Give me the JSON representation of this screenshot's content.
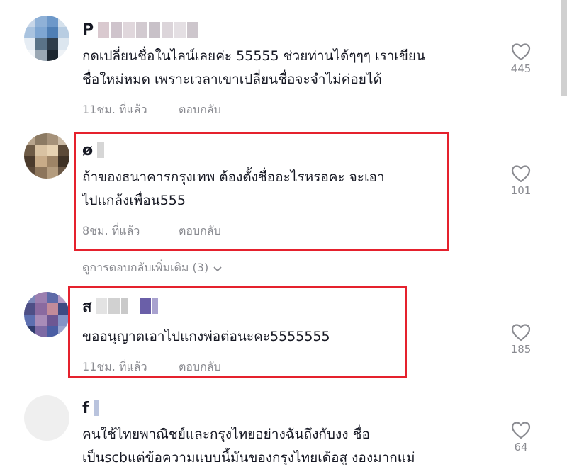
{
  "comments": [
    {
      "name_initial": "P",
      "text_line1": "กดเปลี่ยนชื่อในไลน์เลยค่ะ 55555 ช่วยท่านได้ๆๆๆ เราเขียน",
      "text_line2": "ชื่อใหม่หมด เพราะเวลาเขาเปลี่ยนชื่อจะจำไม่ค่อยได้",
      "time": "11ชม. ที่แล้ว",
      "reply": "ตอบกลับ",
      "likes": "445",
      "like_icon": "heart-outline-icon"
    },
    {
      "name_initial": "ø",
      "text_line1": "ถ้าของธนาคารกรุงเทพ ต้องตั้งชื่ออะไรหรอคะ จะเอา",
      "text_line2": "ไปแกล้งเพื่อน555",
      "time": "8ชม. ที่แล้ว",
      "reply": "ตอบกลับ",
      "likes": "101",
      "like_icon": "heart-outline-icon"
    },
    {
      "name_initial": "ส",
      "text_line1": "ขออนุญาตเอาไปแกงพ่อต่อนะคะ5555555",
      "time": "11ชม. ที่แล้ว",
      "reply": "ตอบกลับ",
      "likes": "185",
      "like_icon": "heart-outline-icon"
    },
    {
      "name_initial": "f",
      "text_line1": "คนใช้ไทยพาณิชย์และกรุงไทยอย่างฉันถึงกับงง ชื่อ",
      "text_line2": "เป็นscbแต่ข้อความแบบนี้มันของกรุงไทยเด้อสู งองมากแม่",
      "likes": "64",
      "like_icon": "heart-outline-icon"
    }
  ],
  "more_replies": {
    "label": "ดูการตอบกลับเพิ่มเติม (3)",
    "icon": "chevron-down-icon"
  },
  "colors": {
    "highlight": "#e5212d",
    "secondary_text": "#8a8b91",
    "primary_text": "#161823"
  }
}
